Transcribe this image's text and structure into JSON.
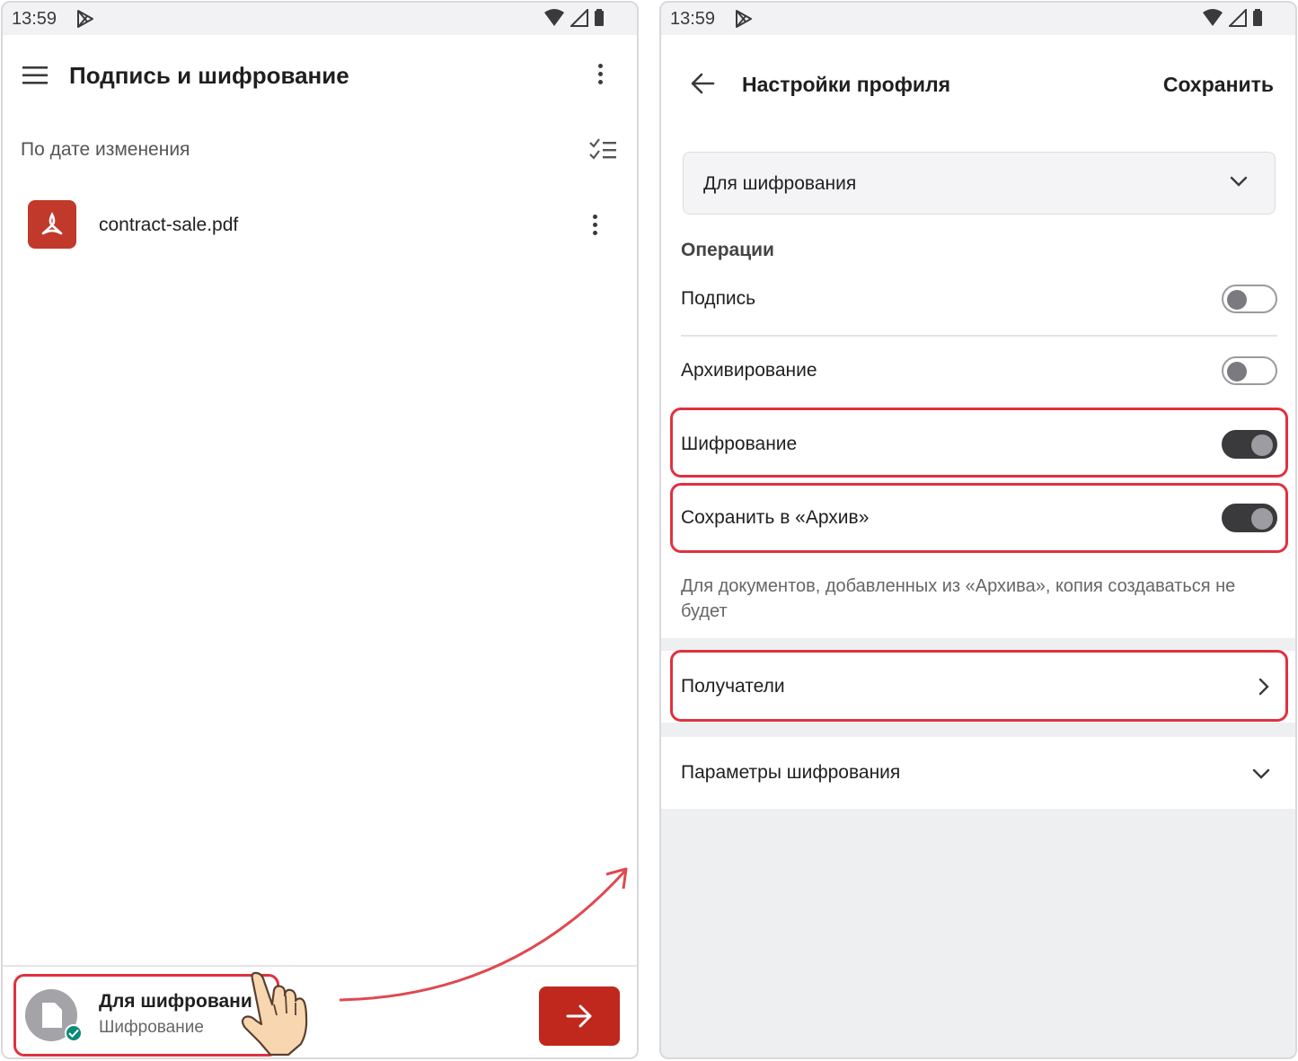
{
  "status_bar": {
    "time": "13:59"
  },
  "left_screen": {
    "title": "Подпись и шифрование",
    "sort_label": "По дате изменения",
    "file": {
      "name": "contract-sale.pdf"
    },
    "profile": {
      "name": "Для шифровани",
      "subtitle": "Шифрование"
    }
  },
  "right_screen": {
    "title": "Настройки профиля",
    "save_label": "Сохранить",
    "profile_select": {
      "value": "Для шифрования"
    },
    "operations_label": "Операции",
    "toggles": [
      {
        "label": "Подпись",
        "state": "off"
      },
      {
        "label": "Архивирование",
        "state": "off"
      },
      {
        "label": "Шифрование",
        "state": "on"
      },
      {
        "label": "Сохранить в «Архив»",
        "state": "on"
      }
    ],
    "archive_note": "Для документов, добавленных из «Архива», копия создаваться не будет",
    "recipients_label": "Получатели",
    "encryption_params_label": "Параметры шифрования"
  },
  "colors": {
    "highlight": "#e0313f",
    "accent_red": "#c0281d",
    "toggle_on": "#3a3a3c"
  }
}
